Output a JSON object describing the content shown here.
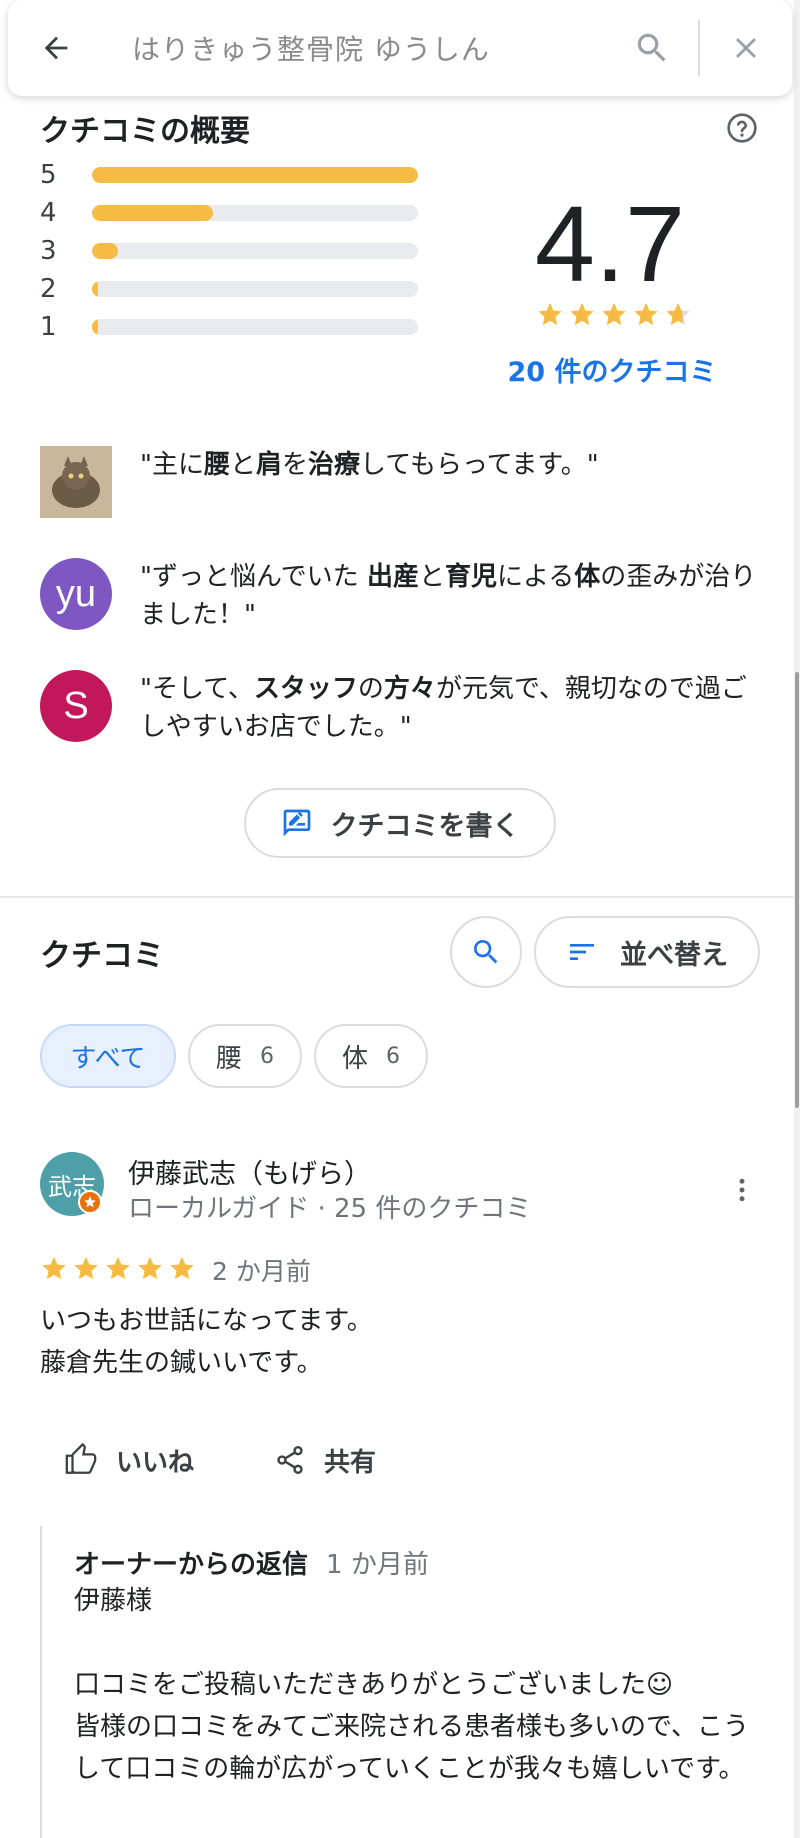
{
  "search": {
    "query": "はりきゅう整骨院 ゆうしん"
  },
  "summary": {
    "title": "クチコミの概要",
    "rating": "4.7",
    "review_count_label": "20 件のクチコミ",
    "bars": [
      {
        "label": "5",
        "fraction": 1.0
      },
      {
        "label": "4",
        "fraction": 0.37
      },
      {
        "label": "3",
        "fraction": 0.08
      },
      {
        "label": "2",
        "fraction": 0.015
      },
      {
        "label": "1",
        "fraction": 0.015
      }
    ],
    "star_fill": [
      1,
      1,
      1,
      1,
      0.7
    ],
    "snippets": [
      {
        "avatar_letter": "",
        "avatar_color": "#a08868",
        "parts": [
          [
            "\"主に",
            false
          ],
          [
            "腰",
            true
          ],
          [
            "と",
            false
          ],
          [
            "肩",
            true
          ],
          [
            "を",
            false
          ],
          [
            "治療",
            true
          ],
          [
            "してもらってます。\"",
            false
          ]
        ]
      },
      {
        "avatar_letter": "yu",
        "avatar_color": "#7e57c2",
        "parts": [
          [
            "\"ずっと悩んでいた ",
            false
          ],
          [
            "出産",
            true
          ],
          [
            "と",
            false
          ],
          [
            "育児",
            true
          ],
          [
            "による",
            false
          ],
          [
            "体",
            true
          ],
          [
            "の歪みが治りました！\"",
            false
          ]
        ]
      },
      {
        "avatar_letter": "S",
        "avatar_color": "#c2185b",
        "parts": [
          [
            "\"そして、",
            false
          ],
          [
            "スタッフ",
            true
          ],
          [
            "の",
            false
          ],
          [
            "方々",
            true
          ],
          [
            "が元気で、親切なので過ごしやすいお店でした。\"",
            false
          ]
        ]
      }
    ],
    "write_review_label": "クチコミを書く"
  },
  "reviews": {
    "title": "クチコミ",
    "sort_label": "並べ替え",
    "chips": [
      {
        "label": "すべて",
        "count": "",
        "selected": true
      },
      {
        "label": "腰",
        "count": "6",
        "selected": false
      },
      {
        "label": "体",
        "count": "6",
        "selected": false
      }
    ],
    "items": [
      {
        "avatar_text": "武志",
        "name": "伊藤武志（もげら）",
        "meta": "ローカルガイド · 25 件のクチコミ",
        "stars": 5,
        "date": "2 か月前",
        "body": "いつもお世話になってます。\n藤倉先生の鍼いいです。",
        "like_label": "いいね",
        "share_label": "共有",
        "reply": {
          "title": "オーナーからの返信",
          "date": "1 か月前",
          "body": "伊藤様\n\n口コミをご投稿いただきありがとうございました☺\n皆様の口コミをみてご来院される患者様も多いので、こうして口コミの輪が広がっていくことが我々も嬉しいです。"
        }
      }
    ]
  },
  "colors": {
    "star": "#f6bb42",
    "link": "#1a73e8",
    "bar_track": "#e8eaed"
  }
}
